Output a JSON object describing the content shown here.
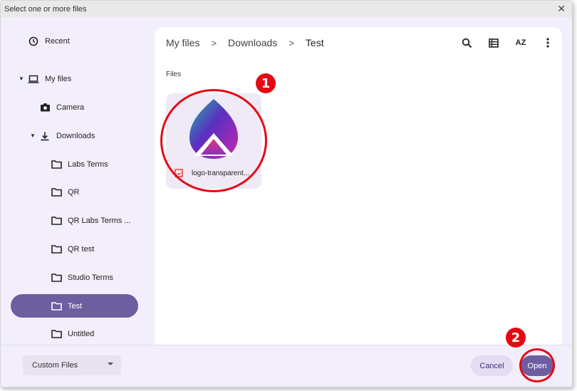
{
  "window": {
    "title": "Select one or more files",
    "close_glyph": "✕"
  },
  "sidebar": {
    "recent": "Recent",
    "my_files": "My files",
    "camera": "Camera",
    "downloads": "Downloads",
    "folders": [
      "Labs Terms",
      "QR",
      "QR Labs Terms ...",
      "QR test",
      "Studio Terms",
      "Test",
      "Untitled"
    ],
    "active": "Test"
  },
  "breadcrumb": {
    "root": "My files",
    "middle": "Downloads",
    "current": "Test",
    "separator": ">"
  },
  "toolbar": {
    "sort_label": "AZ"
  },
  "content": {
    "section_label": "Files",
    "files": [
      {
        "name": "logo-transparent...",
        "icon": "image-file-icon"
      }
    ]
  },
  "annotations": {
    "badge1": "1",
    "badge2": "2"
  },
  "footer": {
    "file_type": "Custom Files",
    "cancel": "Cancel",
    "open": "Open"
  },
  "colors": {
    "accent": "#6d5ea0",
    "annotation": "#e50914",
    "background": "#f3eefb"
  }
}
